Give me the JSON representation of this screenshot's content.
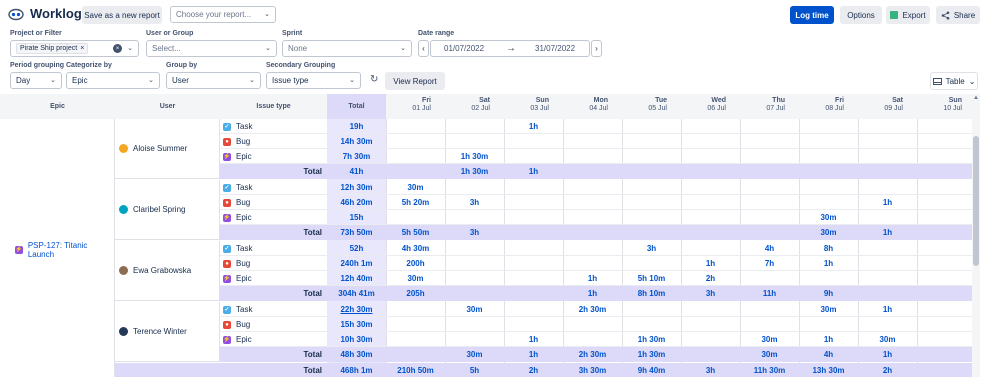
{
  "header": {
    "title": "Worklogs",
    "save_button": "Save as a new report",
    "report_select_placeholder": "Choose your report...",
    "log_time_button": "Log time",
    "options_button": "Options",
    "export_button": "Export",
    "share_button": "Share"
  },
  "filters": {
    "project_label": "Project or Filter",
    "project_tag": "Pirate Ship project",
    "user_label": "User or Group",
    "user_placeholder": "Select...",
    "sprint_label": "Sprint",
    "sprint_value": "None",
    "date_label": "Date range",
    "date_from": "01/07/2022",
    "date_to": "31/07/2022",
    "period_label": "Period grouping",
    "period_value": "Day",
    "categorize_label": "Categorize by",
    "categorize_value": "Epic",
    "group_label": "Group by",
    "group_value": "User",
    "secondary_label": "Secondary Grouping",
    "secondary_value": "Issue type",
    "view_report_button": "View Report",
    "table_view": "Table"
  },
  "columns": {
    "epic": "Epic",
    "user": "User",
    "issue_type": "Issue type",
    "total": "Total",
    "days": [
      {
        "dow": "Fri",
        "date": "01 Jul"
      },
      {
        "dow": "Sat",
        "date": "02 Jul"
      },
      {
        "dow": "Sun",
        "date": "03 Jul"
      },
      {
        "dow": "Mon",
        "date": "04 Jul"
      },
      {
        "dow": "Tue",
        "date": "05 Jul"
      },
      {
        "dow": "Wed",
        "date": "06 Jul"
      },
      {
        "dow": "Thu",
        "date": "07 Jul"
      },
      {
        "dow": "Fri",
        "date": "08 Jul"
      },
      {
        "dow": "Sat",
        "date": "09 Jul"
      },
      {
        "dow": "Sun",
        "date": "10 Jul"
      }
    ]
  },
  "epic": {
    "name": "PSP-127: Titanic Launch"
  },
  "users": [
    {
      "name": "Aloise Summer",
      "avatar_color": "#f5a623",
      "rows": [
        {
          "type": "Task",
          "total": "19h",
          "days": [
            "",
            "",
            "1h",
            "",
            "",
            "",
            "",
            "",
            "",
            ""
          ]
        },
        {
          "type": "Bug",
          "total": "14h 30m",
          "days": [
            "",
            "",
            "",
            "",
            "",
            "",
            "",
            "",
            "",
            ""
          ]
        },
        {
          "type": "Epic",
          "total": "7h 30m",
          "days": [
            "",
            "1h 30m",
            "",
            "",
            "",
            "",
            "",
            "",
            "",
            ""
          ]
        }
      ],
      "total_label": "Total",
      "total": {
        "total": "41h",
        "days": [
          "",
          "1h 30m",
          "1h",
          "",
          "",
          "",
          "",
          "",
          "",
          ""
        ]
      }
    },
    {
      "name": "Claribel Spring",
      "avatar_color": "#00a3bf",
      "rows": [
        {
          "type": "Task",
          "total": "12h 30m",
          "days": [
            "30m",
            "",
            "",
            "",
            "",
            "",
            "",
            "",
            "",
            ""
          ]
        },
        {
          "type": "Bug",
          "total": "46h 20m",
          "days": [
            "5h 20m",
            "3h",
            "",
            "",
            "",
            "",
            "",
            "",
            "1h",
            ""
          ]
        },
        {
          "type": "Epic",
          "total": "15h",
          "days": [
            "",
            "",
            "",
            "",
            "",
            "",
            "",
            "30m",
            "",
            ""
          ]
        }
      ],
      "total_label": "Total",
      "total": {
        "total": "73h 50m",
        "days": [
          "5h 50m",
          "3h",
          "",
          "",
          "",
          "",
          "",
          "30m",
          "1h",
          ""
        ]
      }
    },
    {
      "name": "Ewa Grabowska",
      "avatar_color": "#8c6d52",
      "rows": [
        {
          "type": "Task",
          "total": "52h",
          "days": [
            "4h 30m",
            "",
            "",
            "",
            "3h",
            "",
            "4h",
            "8h",
            "",
            ""
          ]
        },
        {
          "type": "Bug",
          "total": "240h 1m",
          "days": [
            "200h",
            "",
            "",
            "",
            "",
            "1h",
            "7h",
            "1h",
            "",
            ""
          ]
        },
        {
          "type": "Epic",
          "total": "12h 40m",
          "days": [
            "30m",
            "",
            "",
            "1h",
            "5h 10m",
            "2h",
            "",
            "",
            "",
            ""
          ]
        }
      ],
      "total_label": "Total",
      "total": {
        "total": "304h 41m",
        "days": [
          "205h",
          "",
          "",
          "1h",
          "8h 10m",
          "3h",
          "11h",
          "9h",
          "",
          ""
        ]
      }
    },
    {
      "name": "Terence Winter",
      "avatar_color": "#253858",
      "rows": [
        {
          "type": "Task",
          "total": "22h 30m",
          "link": true,
          "days": [
            "",
            "30m",
            "",
            "2h 30m",
            "",
            "",
            "",
            "30m",
            "1h",
            ""
          ]
        },
        {
          "type": "Bug",
          "total": "15h 30m",
          "days": [
            "",
            "",
            "",
            "",
            "",
            "",
            "",
            "",
            "",
            ""
          ]
        },
        {
          "type": "Epic",
          "total": "10h 30m",
          "days": [
            "",
            "",
            "1h",
            "",
            "1h 30m",
            "",
            "30m",
            "1h",
            "30m",
            ""
          ]
        }
      ],
      "total_label": "Total",
      "total": {
        "total": "48h 30m",
        "days": [
          "",
          "30m",
          "1h",
          "2h 30m",
          "1h 30m",
          "",
          "30m",
          "4h",
          "1h",
          ""
        ]
      }
    }
  ],
  "grand_total": {
    "label": "Total",
    "total": "468h 1m",
    "days": [
      "210h 50m",
      "5h",
      "2h",
      "3h 30m",
      "9h 40m",
      "3h",
      "11h 30m",
      "13h 30m",
      "2h",
      ""
    ]
  }
}
